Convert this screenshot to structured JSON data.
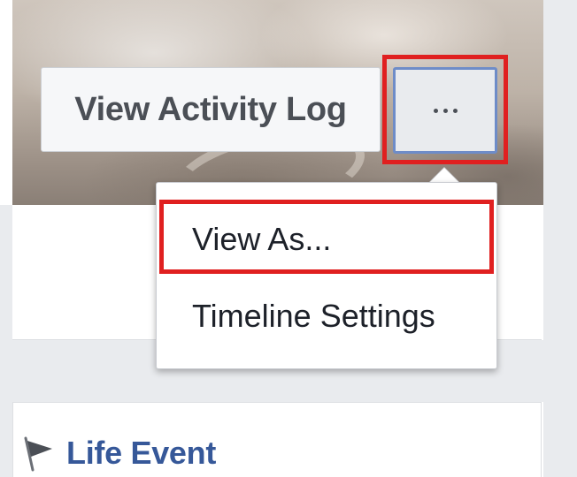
{
  "header": {
    "activity_log_label": "View Activity Log",
    "more_label": "···"
  },
  "menu": {
    "items": [
      {
        "label": "View As..."
      },
      {
        "label": "Timeline Settings"
      }
    ]
  },
  "composer": {
    "life_event_label": "Life Event"
  },
  "colors": {
    "link_blue": "#365899",
    "highlight_red": "#e02020",
    "focus_blue": "#6e8cc8",
    "page_gray": "#e9ebee"
  }
}
